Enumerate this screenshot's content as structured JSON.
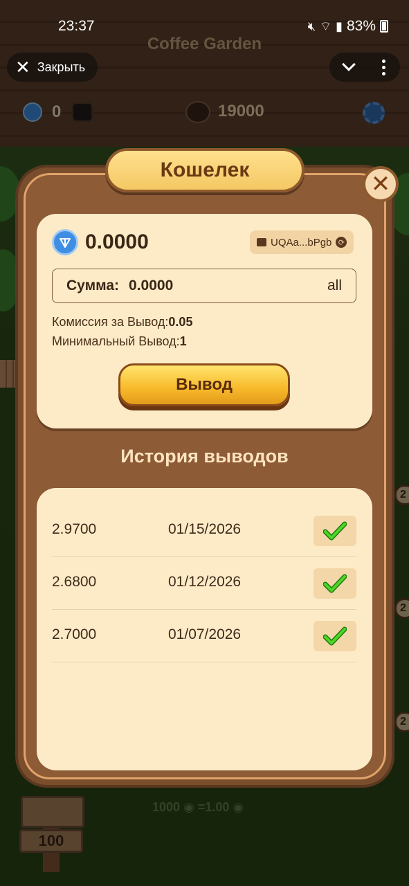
{
  "status_bar": {
    "time": "23:37",
    "battery": "83%"
  },
  "overlay": {
    "close_label": "Закрыть"
  },
  "game": {
    "title": "Coffee Garden",
    "ton_count": "0",
    "beans_count": "19000",
    "rate": "1000",
    "rate_equals": "=1.00",
    "sign_value": "100",
    "side_badge": "2"
  },
  "wallet": {
    "title": "Кошелек",
    "balance": "0.0000",
    "address": "UQAa...bPgb",
    "amount_label": "Сумма:",
    "amount_value": "0.0000",
    "all_label": "all",
    "fee_label": "Комиссия за Вывод:",
    "fee_value": "0.05",
    "min_label": "Минимальный Вывод:",
    "min_value": "1",
    "withdraw_button": "Вывод"
  },
  "history": {
    "title": "История выводов",
    "rows": [
      {
        "amount": "2.9700",
        "date": "01/15/2026",
        "status": "completed"
      },
      {
        "amount": "2.6800",
        "date": "01/12/2026",
        "status": "completed"
      },
      {
        "amount": "2.7000",
        "date": "01/07/2026",
        "status": "completed"
      }
    ]
  },
  "colors": {
    "modal_brown": "#8d5b35",
    "card_cream": "#fdebc8",
    "button_gold": "#f7b92a",
    "check_green": "#3cc21b"
  }
}
